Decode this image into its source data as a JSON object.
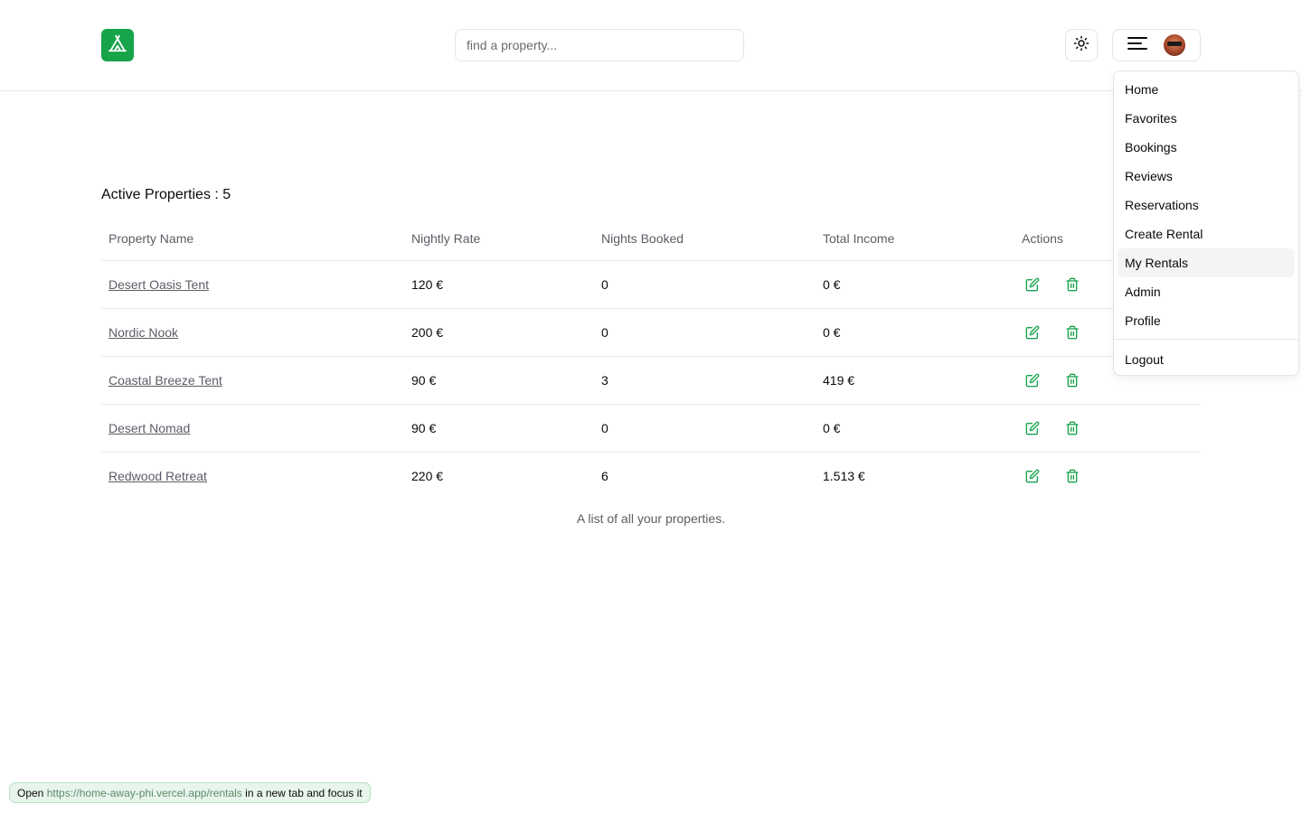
{
  "header": {
    "logo_icon": "tent-icon",
    "search_placeholder": "find a property...",
    "theme_icon": "sun-icon",
    "menu_icon": "hamburger-icon"
  },
  "main": {
    "title": "Active Properties : 5",
    "columns": [
      "Property Name",
      "Nightly Rate",
      "Nights Booked",
      "Total Income",
      "Actions"
    ],
    "rows": [
      {
        "name": "Desert Oasis Tent",
        "rate": "120 €",
        "nights": "0",
        "income": "0 €"
      },
      {
        "name": "Nordic Nook",
        "rate": "200 €",
        "nights": "0",
        "income": "0 €"
      },
      {
        "name": "Coastal Breeze Tent",
        "rate": "90 €",
        "nights": "3",
        "income": "419 €"
      },
      {
        "name": "Desert Nomad",
        "rate": "90 €",
        "nights": "0",
        "income": "0 €"
      },
      {
        "name": "Redwood Retreat",
        "rate": "220 €",
        "nights": "6",
        "income": "1.513 €"
      }
    ],
    "caption": "A list of all your properties."
  },
  "dropdown": {
    "items": [
      "Home",
      "Favorites",
      "Bookings",
      "Reviews",
      "Reservations",
      "Create Rental",
      "My Rentals",
      "Admin",
      "Profile"
    ],
    "active_item": "My Rentals",
    "logout": "Logout"
  },
  "tooltip": {
    "prefix": "Open",
    "url": "https://home-away-phi.vercel.app/rentals",
    "suffix": "in a new tab and focus it"
  },
  "colors": {
    "accent": "#16a34a",
    "icon_green": "#16a34a"
  }
}
